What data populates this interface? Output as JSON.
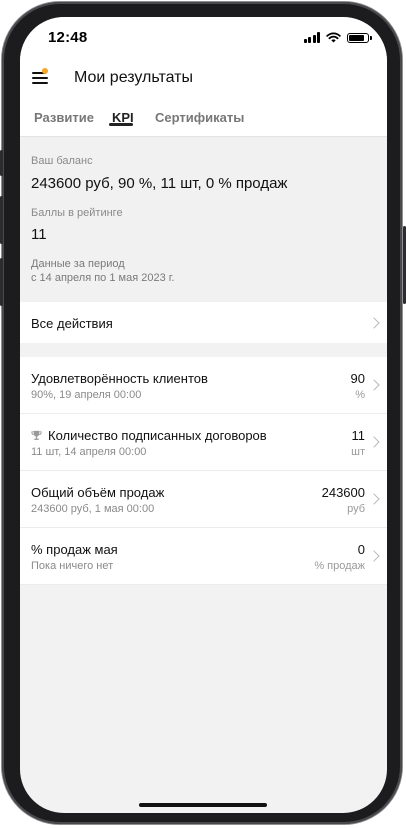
{
  "status_bar": {
    "time": "12:48",
    "battery_level": 0.9
  },
  "header": {
    "title": "Мои результаты",
    "menu_icon": "hamburger-icon",
    "notification_dot_color": "#f5a623"
  },
  "tabs": [
    {
      "label": "Развитие",
      "active": false
    },
    {
      "label": "KPI",
      "active": true
    },
    {
      "label": "Сертификаты",
      "active": false
    }
  ],
  "balance": {
    "label": "Ваш баланс",
    "value": "243600 руб, 90 %, 11 шт, 0 % продаж",
    "rating_label": "Баллы в рейтинге",
    "rating_value": "11",
    "period_label": "Данные за период",
    "period_value": "с 14 апреля по 1 мая 2023 г."
  },
  "all_actions": {
    "label": "Все действия"
  },
  "kpis": [
    {
      "title": "Удовлетворённость клиентов",
      "subtitle": "90%, 19 апреля 00:00",
      "value": "90",
      "unit": "%",
      "icon": null
    },
    {
      "title": "Количество подписанных договоров",
      "subtitle": "11 шт, 14 апреля 00:00",
      "value": "11",
      "unit": "шт",
      "icon": "trophy-icon"
    },
    {
      "title": "Общий объём продаж",
      "subtitle": "243600 руб, 1 мая 00:00",
      "value": "243600",
      "unit": "руб",
      "icon": null
    },
    {
      "title": "% продаж мая",
      "subtitle": "Пока ничего нет",
      "value": "0",
      "unit": "% продаж",
      "icon": null
    }
  ],
  "colors": {
    "background": "#f2f2f2",
    "surface": "#ffffff",
    "accent": "#222222",
    "muted_text": "#8a8a8a"
  }
}
